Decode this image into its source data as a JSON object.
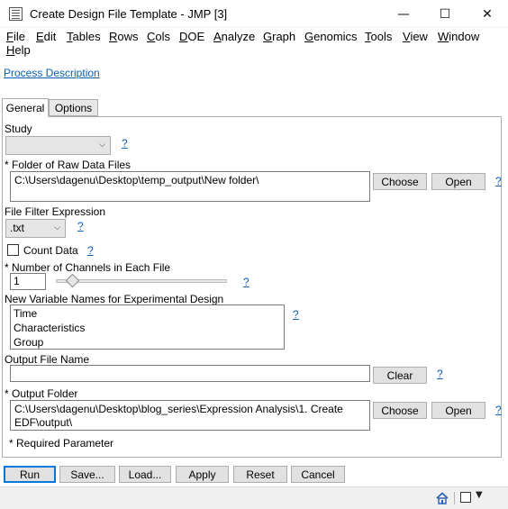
{
  "window": {
    "title": "Create Design File Template - JMP [3]",
    "minimize": "—",
    "maximize": "☐",
    "close": "✕"
  },
  "menu": [
    "File",
    "Edit",
    "Tables",
    "Rows",
    "Cols",
    "DOE",
    "Analyze",
    "Graph",
    "Genomics",
    "Tools",
    "View",
    "Window",
    "Help"
  ],
  "process_description": "Process Description",
  "tabs": {
    "general": "General",
    "options": "Options"
  },
  "study": {
    "label": "Study",
    "value": "",
    "help": "?"
  },
  "raw_folder": {
    "label": "* Folder of Raw Data Files",
    "value": "C:\\Users\\dagenu\\Desktop\\temp_output\\New folder\\",
    "choose": "Choose",
    "open": "Open",
    "help": "?"
  },
  "filter": {
    "label": "File Filter Expression",
    "value": ".txt",
    "help": "?"
  },
  "count_data": {
    "label": "Count Data",
    "help": "?"
  },
  "channels": {
    "label": "* Number of Channels in Each File",
    "value": "1",
    "slider_fraction": 0.05,
    "help": "?"
  },
  "variables": {
    "label": "New Variable Names for Experimental Design",
    "items": [
      "Time",
      "Characteristics",
      "Group"
    ],
    "help": "?"
  },
  "output_file": {
    "label": "Output File Name",
    "value": "",
    "clear": "Clear",
    "help": "?"
  },
  "output_folder": {
    "label": "* Output Folder",
    "value": "C:\\Users\\dagenu\\Desktop\\blog_series\\Expression Analysis\\1. Create EDF\\output\\",
    "choose": "Choose",
    "open": "Open",
    "help": "?"
  },
  "required_note": "* Required Parameter",
  "actions": {
    "run": "Run",
    "save": "Save...",
    "load": "Load...",
    "apply": "Apply",
    "reset": "Reset",
    "cancel": "Cancel"
  },
  "colors": {
    "link": "#0b5fb5",
    "accent": "#0078d7"
  }
}
